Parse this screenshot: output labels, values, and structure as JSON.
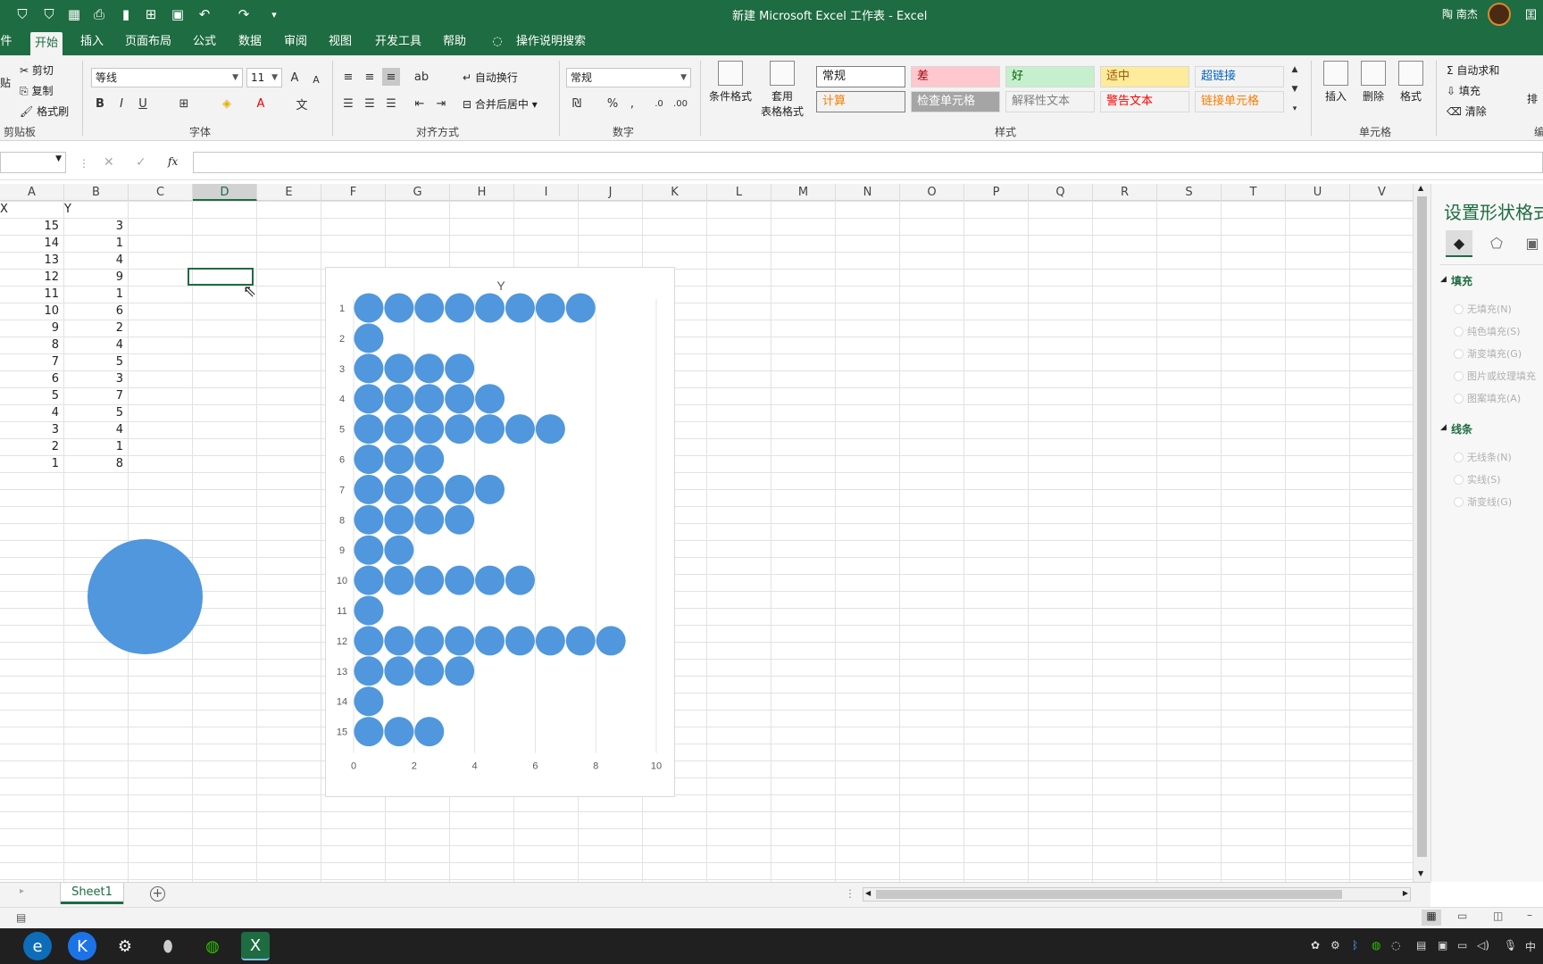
{
  "titlebar": {
    "title": "新建 Microsoft Excel 工作表 - Excel",
    "user": "陶 南杰",
    "extra": "囯"
  },
  "ribbon_tabs": [
    "件",
    "开始",
    "插入",
    "页面布局",
    "公式",
    "数据",
    "审阅",
    "视图",
    "开发工具",
    "帮助",
    "操作说明搜索"
  ],
  "clipboard": {
    "cut": "剪切",
    "copy": "复制",
    "format_painter": "格式刷",
    "paste_partial": "贴",
    "label": "剪贴板"
  },
  "font": {
    "name": "等线",
    "size": "11",
    "label": "字体",
    "bold": "B",
    "italic": "I",
    "underline": "U",
    "increase": "A",
    "decrease": "A"
  },
  "alignment": {
    "wrap": "自动换行",
    "merge": "合并后居中",
    "label": "对齐方式"
  },
  "number": {
    "format": "常规",
    "percent": "%",
    "comma": ",",
    "label": "数字"
  },
  "styles": {
    "conditional": [
      "条件格式"
    ],
    "table": [
      "套用",
      "表格格式"
    ],
    "cells": [
      {
        "text": "常规",
        "bg": "#ffffff",
        "color": "#222222"
      },
      {
        "text": "差",
        "bg": "#ffc7ce",
        "color": "#9c0006"
      },
      {
        "text": "好",
        "bg": "#c6efce",
        "color": "#006100"
      },
      {
        "text": "适中",
        "bg": "#ffeb9c",
        "color": "#9c5700"
      },
      {
        "text": "超链接",
        "bg": "#f3f3f3",
        "color": "#0563c1"
      },
      {
        "text": "计算",
        "bg": "#f2f2f2",
        "color": "#fa7d00"
      },
      {
        "text": "检查单元格",
        "bg": "#a5a5a5",
        "color": "#ffffff"
      },
      {
        "text": "解释性文本",
        "bg": "#f3f3f3",
        "color": "#7f7f7f"
      },
      {
        "text": "警告文本",
        "bg": "#f3f3f3",
        "color": "#ff0000"
      },
      {
        "text": "链接单元格",
        "bg": "#f3f3f3",
        "color": "#fa7d00"
      }
    ],
    "label": "样式"
  },
  "cells_group": {
    "insert": "插入",
    "delete": "删除",
    "format": "格式",
    "label": "单元格"
  },
  "editing": {
    "autosum": "自动求和",
    "fill": "填充",
    "clear": "清除",
    "sort_partial": "排",
    "label_partial": "编"
  },
  "formula_bar": {
    "fx": "fx",
    "cancel": "✕",
    "enter": "✓"
  },
  "columns": [
    "A",
    "B",
    "C",
    "D",
    "E",
    "F",
    "G",
    "H",
    "I",
    "J",
    "K",
    "L",
    "M",
    "N",
    "O",
    "P",
    "Q",
    "R",
    "S",
    "T",
    "U",
    "V"
  ],
  "table": {
    "headers": [
      "X",
      "Y"
    ],
    "rows": [
      [
        "15",
        "3"
      ],
      [
        "14",
        "1"
      ],
      [
        "13",
        "4"
      ],
      [
        "12",
        "9"
      ],
      [
        "11",
        "1"
      ],
      [
        "10",
        "6"
      ],
      [
        "9",
        "2"
      ],
      [
        "8",
        "4"
      ],
      [
        "7",
        "5"
      ],
      [
        "6",
        "3"
      ],
      [
        "5",
        "7"
      ],
      [
        "4",
        "5"
      ],
      [
        "3",
        "4"
      ],
      [
        "2",
        "1"
      ],
      [
        "1",
        "8"
      ]
    ]
  },
  "chart_data": {
    "type": "scatter",
    "title": "Y",
    "categories": [
      "1",
      "2",
      "3",
      "4",
      "5",
      "6",
      "7",
      "8",
      "9",
      "10",
      "11",
      "12",
      "13",
      "14",
      "15"
    ],
    "values": [
      8,
      1,
      4,
      5,
      7,
      3,
      5,
      4,
      2,
      6,
      1,
      9,
      4,
      1,
      3
    ],
    "xlim": [
      0,
      10
    ],
    "xticks": [
      "0",
      "2",
      "4",
      "6",
      "8",
      "10"
    ],
    "marker": "circle",
    "color": "#5097dd",
    "grid": "vertical"
  },
  "pane": {
    "title": "设置形状格式",
    "fill_section": "填充",
    "fill_options": [
      "无填充(N)",
      "纯色填充(S)",
      "渐变填充(G)",
      "图片或纹理填充",
      "图案填充(A)"
    ],
    "line_section": "线条",
    "line_options": [
      "无线条(N)",
      "实线(S)",
      "渐变线(G)"
    ]
  },
  "sheet": {
    "tab": "Sheet1",
    "add": "+"
  },
  "taskbar": {
    "ime": "中"
  }
}
